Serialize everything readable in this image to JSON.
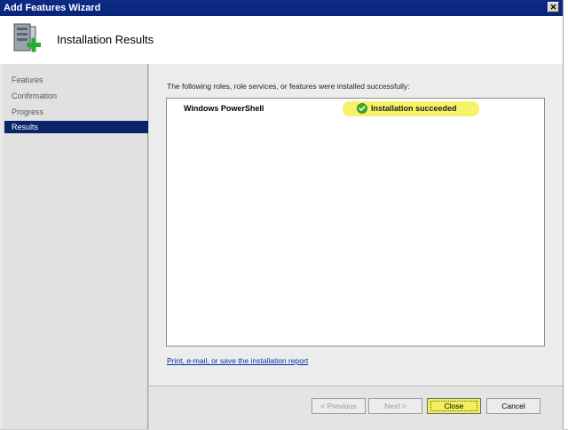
{
  "window": {
    "title": "Add Features Wizard"
  },
  "header": {
    "title": "Installation Results"
  },
  "sidebar": {
    "items": [
      {
        "label": "Features"
      },
      {
        "label": "Confirmation"
      },
      {
        "label": "Progress"
      },
      {
        "label": "Results"
      }
    ],
    "active": "Results"
  },
  "main": {
    "intro": "The following roles, role services, or features were installed successfully:",
    "results": [
      {
        "name": "Windows PowerShell",
        "status": "Installation succeeded"
      }
    ],
    "report_link": "Print, e-mail, or save the installation report"
  },
  "footer": {
    "previous_label": "< Previous",
    "next_label": "Next >",
    "close_label": "Close",
    "cancel_label": "Cancel"
  },
  "colors": {
    "title_bar": "#0c2a86",
    "selected_item": "#0a246a",
    "highlight": "#f6f36a",
    "success_icon": "#3fae2a"
  },
  "icons": {
    "header": "server-add-icon",
    "status": "check-icon",
    "close": "close-icon"
  }
}
